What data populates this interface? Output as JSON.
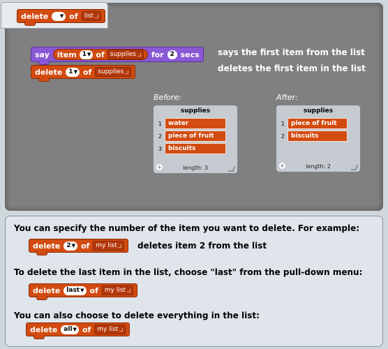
{
  "tab_block": {
    "delete": "delete",
    "of": "of",
    "list": "list"
  },
  "demo": {
    "say_block": {
      "say": "say",
      "item": "item",
      "item_num": "1",
      "of": "of",
      "list": "supplies",
      "for": "for",
      "secs_num": "2",
      "secs": "secs"
    },
    "delete_block": {
      "delete": "delete",
      "num": "1",
      "of": "of",
      "list": "supplies"
    },
    "desc1": "says the first item from the list",
    "desc2": "deletes the first item in the list",
    "before_label": "Before:",
    "after_label": "After:",
    "before_watcher": {
      "title": "supplies",
      "items": [
        {
          "idx": "1",
          "text": "water"
        },
        {
          "idx": "2",
          "text": "piece of fruit"
        },
        {
          "idx": "3",
          "text": "biscuits"
        }
      ],
      "length": "length: 3"
    },
    "after_watcher": {
      "title": "supplies",
      "items": [
        {
          "idx": "1",
          "text": "piece of fruit"
        },
        {
          "idx": "2",
          "text": "biscuits"
        }
      ],
      "length": "length: 2"
    }
  },
  "info": {
    "p1": "You can specify the number of the item you want to delete. For example:",
    "ex1": {
      "delete": "delete",
      "num": "2",
      "of": "of",
      "list": "my list"
    },
    "ex1_desc": "deletes item 2 from the list",
    "p2": "To delete the last item in the list, choose \"last\" from the pull-down menu:",
    "ex2": {
      "delete": "delete",
      "num": "last",
      "of": "of",
      "list": "my list"
    },
    "p3": "You can also choose to delete everything in the list:",
    "ex3": {
      "delete": "delete",
      "num": "all",
      "of": "of",
      "list": "my list"
    }
  },
  "colors": {
    "block_orange": "#d24b10",
    "looks_purple": "#8a58d4",
    "panel_grey": "#808080",
    "info_bg": "#dfe5eb"
  }
}
